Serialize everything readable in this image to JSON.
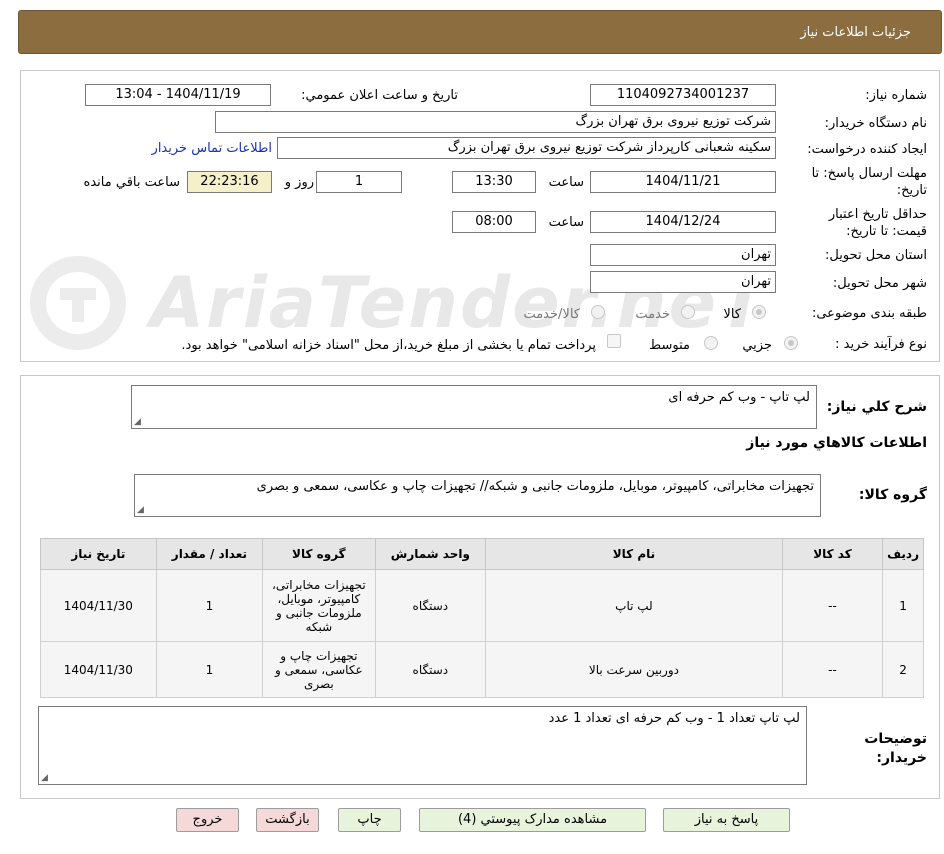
{
  "header": {
    "title": "جزئیات اطلاعات نیاز"
  },
  "watermark": {
    "text": "AriaTender.neT"
  },
  "form": {
    "need_number_label": "شماره نیاز:",
    "need_number": "1104092734001237",
    "announce_label": "تاریخ و ساعت اعلان عمومي:",
    "announce_value": "1404/11/19 - 13:04",
    "buyer_org_label": "نام دستگاه خریدار:",
    "buyer_org": "شرکت توزیع نیروی برق تهران بزرگ",
    "creator_label": "ایجاد کننده درخواست:",
    "creator": "سکینه شعبانی کارپرداز شرکت توزیع نیروی برق تهران بزرگ",
    "buyer_contact_link": "اطلاعات تماس خریدار",
    "deadline_label": "مهلت ارسال پاسخ: تا تاریخ:",
    "deadline_date": "1404/11/21",
    "time_label": "ساعت",
    "deadline_time": "13:30",
    "days_remaining": "1",
    "days_label": "روز و",
    "time_remaining": "22:23:16",
    "remaining_label": "ساعت باقي مانده",
    "validity_label": "حداقل تاریخ اعتبار قیمت: تا تاریخ:",
    "validity_date": "1404/12/24",
    "validity_time": "08:00",
    "province_label": "استان محل تحویل:",
    "province": "تهران",
    "city_label": "شهر محل تحویل:",
    "city": "تهران",
    "category_label": "طبقه بندی موضوعی:",
    "category_options": [
      "کالا",
      "خدمت",
      "کالا/خدمت"
    ],
    "process_label": "نوع فرآیند خرید :",
    "process_options": [
      "جزیي",
      "متوسط"
    ],
    "payment_note": "پرداخت تمام یا بخشی از مبلغ خرید،از محل \"اسناد خزانه اسلامی\" خواهد بود."
  },
  "description": {
    "general_label": "شرح کلي نياز:",
    "general_value": "لپ تاپ - وب کم حرفه ای",
    "items_title": "اطلاعات کالاهاي مورد نياز",
    "group_label": "گروه کالا:",
    "group_value": "تجهیزات مخابراتی، کامپیوتر، موبایل، ملزومات جانبی و شبکه// تجهیزات چاپ و عکاسی، سمعی و بصری"
  },
  "table": {
    "headers": [
      "ردیف",
      "کد کالا",
      "نام کالا",
      "واحد شمارش",
      "گروه کالا",
      "تعداد / مقدار",
      "تاریخ نیاز"
    ],
    "rows": [
      [
        "1",
        "--",
        "لپ تاپ",
        "دستگاه",
        "تجهیزات مخابراتی، کامپیوتر، موبایل، ملزومات جانبی و شبکه",
        "1",
        "1404/11/30"
      ],
      [
        "2",
        "--",
        "دوربین سرعت بالا",
        "دستگاه",
        "تجهیزات چاپ و عکاسی، سمعی و بصری",
        "1",
        "1404/11/30"
      ]
    ]
  },
  "buyer_notes": {
    "label": "توضیحات خریدار:",
    "value": "لپ تاپ تعداد 1 - وب کم حرفه ای تعداد 1 عدد"
  },
  "buttons": {
    "reply": "پاسخ به نیاز",
    "attachments": "مشاهده مدارک پیوستي (4)",
    "print": "چاپ",
    "back": "بازگشت",
    "exit": "خروج"
  }
}
